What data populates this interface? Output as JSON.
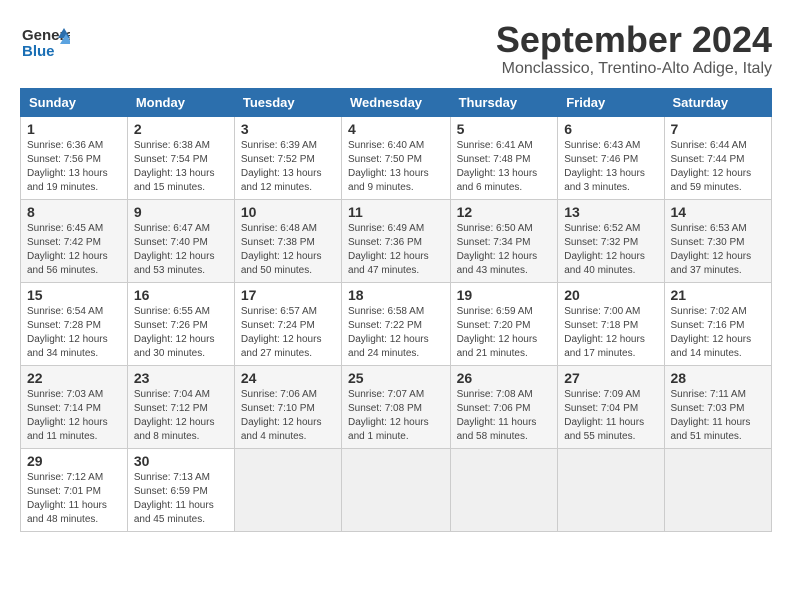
{
  "header": {
    "logo_line1": "General",
    "logo_line2": "Blue",
    "month": "September 2024",
    "location": "Monclassico, Trentino-Alto Adige, Italy"
  },
  "weekdays": [
    "Sunday",
    "Monday",
    "Tuesday",
    "Wednesday",
    "Thursday",
    "Friday",
    "Saturday"
  ],
  "weeks": [
    [
      {
        "day": "1",
        "info": "Sunrise: 6:36 AM\nSunset: 7:56 PM\nDaylight: 13 hours and 19 minutes."
      },
      {
        "day": "2",
        "info": "Sunrise: 6:38 AM\nSunset: 7:54 PM\nDaylight: 13 hours and 15 minutes."
      },
      {
        "day": "3",
        "info": "Sunrise: 6:39 AM\nSunset: 7:52 PM\nDaylight: 13 hours and 12 minutes."
      },
      {
        "day": "4",
        "info": "Sunrise: 6:40 AM\nSunset: 7:50 PM\nDaylight: 13 hours and 9 minutes."
      },
      {
        "day": "5",
        "info": "Sunrise: 6:41 AM\nSunset: 7:48 PM\nDaylight: 13 hours and 6 minutes."
      },
      {
        "day": "6",
        "info": "Sunrise: 6:43 AM\nSunset: 7:46 PM\nDaylight: 13 hours and 3 minutes."
      },
      {
        "day": "7",
        "info": "Sunrise: 6:44 AM\nSunset: 7:44 PM\nDaylight: 12 hours and 59 minutes."
      }
    ],
    [
      {
        "day": "8",
        "info": "Sunrise: 6:45 AM\nSunset: 7:42 PM\nDaylight: 12 hours and 56 minutes."
      },
      {
        "day": "9",
        "info": "Sunrise: 6:47 AM\nSunset: 7:40 PM\nDaylight: 12 hours and 53 minutes."
      },
      {
        "day": "10",
        "info": "Sunrise: 6:48 AM\nSunset: 7:38 PM\nDaylight: 12 hours and 50 minutes."
      },
      {
        "day": "11",
        "info": "Sunrise: 6:49 AM\nSunset: 7:36 PM\nDaylight: 12 hours and 47 minutes."
      },
      {
        "day": "12",
        "info": "Sunrise: 6:50 AM\nSunset: 7:34 PM\nDaylight: 12 hours and 43 minutes."
      },
      {
        "day": "13",
        "info": "Sunrise: 6:52 AM\nSunset: 7:32 PM\nDaylight: 12 hours and 40 minutes."
      },
      {
        "day": "14",
        "info": "Sunrise: 6:53 AM\nSunset: 7:30 PM\nDaylight: 12 hours and 37 minutes."
      }
    ],
    [
      {
        "day": "15",
        "info": "Sunrise: 6:54 AM\nSunset: 7:28 PM\nDaylight: 12 hours and 34 minutes."
      },
      {
        "day": "16",
        "info": "Sunrise: 6:55 AM\nSunset: 7:26 PM\nDaylight: 12 hours and 30 minutes."
      },
      {
        "day": "17",
        "info": "Sunrise: 6:57 AM\nSunset: 7:24 PM\nDaylight: 12 hours and 27 minutes."
      },
      {
        "day": "18",
        "info": "Sunrise: 6:58 AM\nSunset: 7:22 PM\nDaylight: 12 hours and 24 minutes."
      },
      {
        "day": "19",
        "info": "Sunrise: 6:59 AM\nSunset: 7:20 PM\nDaylight: 12 hours and 21 minutes."
      },
      {
        "day": "20",
        "info": "Sunrise: 7:00 AM\nSunset: 7:18 PM\nDaylight: 12 hours and 17 minutes."
      },
      {
        "day": "21",
        "info": "Sunrise: 7:02 AM\nSunset: 7:16 PM\nDaylight: 12 hours and 14 minutes."
      }
    ],
    [
      {
        "day": "22",
        "info": "Sunrise: 7:03 AM\nSunset: 7:14 PM\nDaylight: 12 hours and 11 minutes."
      },
      {
        "day": "23",
        "info": "Sunrise: 7:04 AM\nSunset: 7:12 PM\nDaylight: 12 hours and 8 minutes."
      },
      {
        "day": "24",
        "info": "Sunrise: 7:06 AM\nSunset: 7:10 PM\nDaylight: 12 hours and 4 minutes."
      },
      {
        "day": "25",
        "info": "Sunrise: 7:07 AM\nSunset: 7:08 PM\nDaylight: 12 hours and 1 minute."
      },
      {
        "day": "26",
        "info": "Sunrise: 7:08 AM\nSunset: 7:06 PM\nDaylight: 11 hours and 58 minutes."
      },
      {
        "day": "27",
        "info": "Sunrise: 7:09 AM\nSunset: 7:04 PM\nDaylight: 11 hours and 55 minutes."
      },
      {
        "day": "28",
        "info": "Sunrise: 7:11 AM\nSunset: 7:03 PM\nDaylight: 11 hours and 51 minutes."
      }
    ],
    [
      {
        "day": "29",
        "info": "Sunrise: 7:12 AM\nSunset: 7:01 PM\nDaylight: 11 hours and 48 minutes."
      },
      {
        "day": "30",
        "info": "Sunrise: 7:13 AM\nSunset: 6:59 PM\nDaylight: 11 hours and 45 minutes."
      },
      {
        "day": "",
        "info": ""
      },
      {
        "day": "",
        "info": ""
      },
      {
        "day": "",
        "info": ""
      },
      {
        "day": "",
        "info": ""
      },
      {
        "day": "",
        "info": ""
      }
    ]
  ]
}
